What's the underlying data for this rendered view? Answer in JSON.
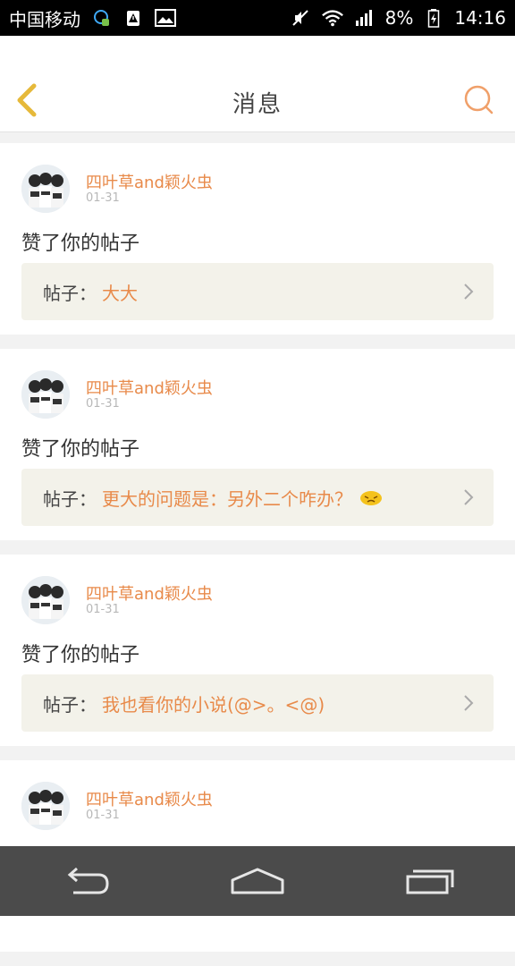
{
  "status_bar": {
    "carrier": "中国移动",
    "battery_percent": "8%",
    "time": "14:16"
  },
  "header": {
    "title": "消息"
  },
  "notifications": [
    {
      "username": "四叶草and颖火虫",
      "date": "01-31",
      "action": "赞了你的帖子",
      "post_prefix": "帖子：",
      "post_title": "大大",
      "has_emoji": false
    },
    {
      "username": "四叶草and颖火虫",
      "date": "01-31",
      "action": "赞了你的帖子",
      "post_prefix": "帖子：",
      "post_title": "更大的问题是：另外二个咋办？",
      "has_emoji": true
    },
    {
      "username": "四叶草and颖火虫",
      "date": "01-31",
      "action": "赞了你的帖子",
      "post_prefix": "帖子：",
      "post_title": "我也看你的小说(@>。<@)",
      "has_emoji": false
    },
    {
      "username": "四叶草and颖火虫",
      "date": "01-31",
      "action": "",
      "post_prefix": "",
      "post_title": "",
      "has_emoji": false
    }
  ],
  "colors": {
    "accent": "#e88a4a",
    "back_arrow": "#e6b93a",
    "post_bg": "#f3f2ea",
    "nav_bg": "#4b4b4b"
  }
}
